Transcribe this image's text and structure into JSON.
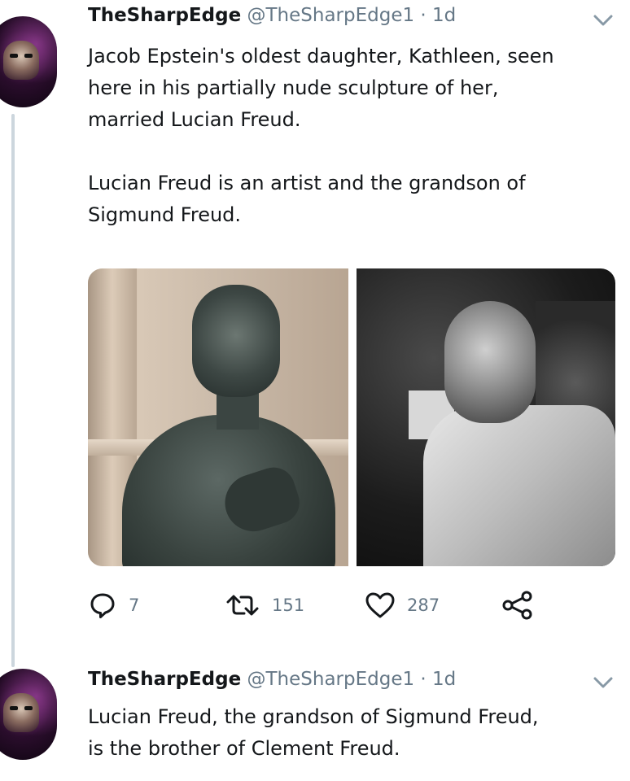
{
  "tweets": [
    {
      "name": "TheSharpEdge",
      "handle": "@TheSharpEdge1",
      "separator": "·",
      "time": "1d",
      "text": "Jacob Epstein's oldest daughter, Kathleen, seen\nhere in his partially nude sculpture of her,\nmarried Lucian Freud.\n\nLucian Freud is an artist and the grandson of\nSigmund Freud.",
      "actions": {
        "replies": "7",
        "retweets": "151",
        "likes": "287"
      }
    },
    {
      "name": "TheSharpEdge",
      "handle": "@TheSharpEdge1",
      "separator": "·",
      "time": "1d",
      "text": "Lucian Freud, the grandson of Sigmund Freud,\nis the brother of Clement Freud."
    }
  ],
  "colors": {
    "text": "#14171a",
    "secondary": "#657786",
    "thread_line": "#ccd6dd"
  }
}
